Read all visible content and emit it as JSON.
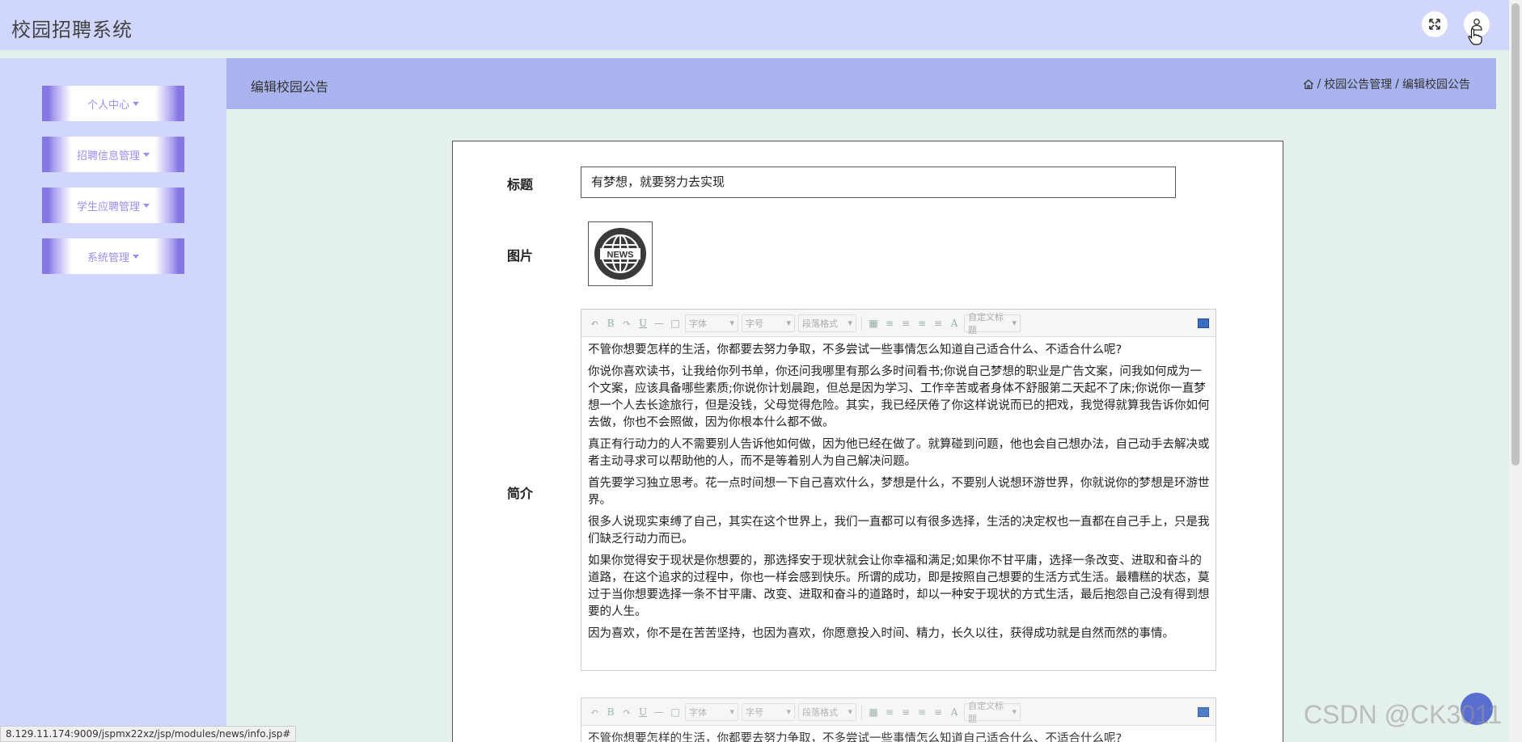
{
  "header": {
    "app_title": "校园招聘系统",
    "fullscreen_icon": "expand-icon",
    "user_icon": "user-icon"
  },
  "sidebar": {
    "items": [
      {
        "label": "个人中心"
      },
      {
        "label": "招聘信息管理"
      },
      {
        "label": "学生应聘管理"
      },
      {
        "label": "系统管理"
      }
    ]
  },
  "breadcrumb": {
    "page_title": "编辑校园公告",
    "home_icon": "home-icon",
    "sep": "/",
    "crumb1": "校园公告管理",
    "crumb2": "编辑校园公告"
  },
  "form": {
    "title_label": "标题",
    "title_value": "有梦想，就要努力去实现",
    "image_label": "图片",
    "image_text": "NEWS",
    "intro_label": "简介",
    "toolbar": {
      "font_family": "字体",
      "font_size": "字号",
      "paragraph": "段落格式",
      "custom_title": "自定义标题",
      "bold": "B",
      "underline": "U",
      "font_color": "A"
    },
    "intro_paragraphs": [
      "不管你想要怎样的生活，你都要去努力争取，不多尝试一些事情怎么知道自己适合什么、不适合什么呢?",
      "你说你喜欢读书，让我给你列书单，你还问我哪里有那么多时间看书;你说自己梦想的职业是广告文案，问我如何成为一个文案，应该具备哪些素质;你说你计划晨跑，但总是因为学习、工作辛苦或者身体不舒服第二天起不了床;你说你一直梦想一个人去长途旅行，但是没钱，父母觉得危险。其实，我已经厌倦了你这样说说而已的把戏，我觉得就算我告诉你如何去做，你也不会照做，因为你根本什么都不做。",
      "真正有行动力的人不需要别人告诉他如何做，因为他已经在做了。就算碰到问题，他也会自己想办法，自己动手去解决或者主动寻求可以帮助他的人，而不是等着别人为自己解决问题。",
      "首先要学习独立思考。花一点时间想一下自己喜欢什么，梦想是什么，不要别人说想环游世界，你就说你的梦想是环游世界。",
      "很多人说现实束缚了自己，其实在这个世界上，我们一直都可以有很多选择，生活的决定权也一直都在自己手上，只是我们缺乏行动力而已。",
      "如果你觉得安于现状是你想要的，那选择安于现状就会让你幸福和满足;如果你不甘平庸，选择一条改变、进取和奋斗的道路，在这个追求的过程中，你也一样会感到快乐。所谓的成功，即是按照自己想要的生活方式生活。最糟糕的状态，莫过于当你想要选择一条不甘平庸、改变、进取和奋斗的道路时，却以一种安于现状的方式生活，最后抱怨自己没有得到想要的人生。",
      "因为喜欢，你不是在苦苦坚持，也因为喜欢，你愿意投入时间、精力，长久以往，获得成功就是自然而然的事情。"
    ],
    "second_editor_first_line": "不管你想要怎样的生活，你都要去努力争取，不多尝试一些事情怎么知道自己适合什么、不适合什么呢?"
  },
  "status_url": "8.129.11.174:9009/jspmx22xz/jsp/modules/news/info.jsp#",
  "watermark": "CSDN @CK3011"
}
